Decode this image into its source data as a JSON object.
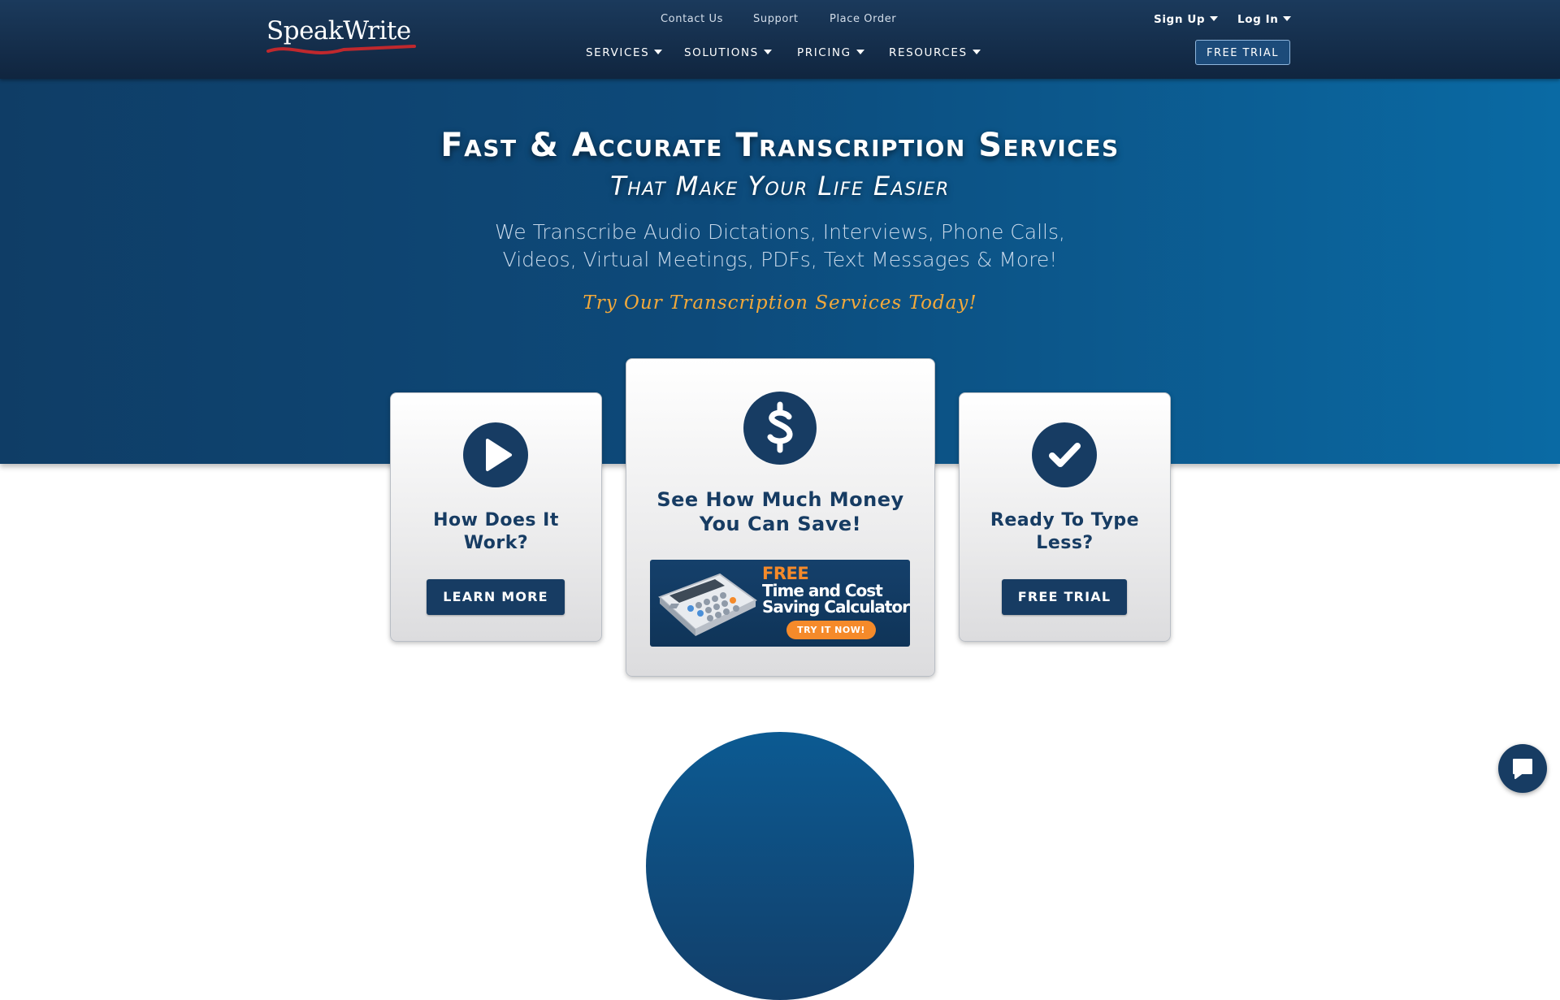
{
  "brand": {
    "logo_text_main": "Speak",
    "logo_text_second": "Write"
  },
  "header": {
    "top_links": [
      "Contact Us",
      "Support",
      "Place Order"
    ],
    "nav": [
      "SERVICES",
      "SOLUTIONS",
      "PRICING",
      "RESOURCES"
    ],
    "account": {
      "signup": "Sign Up",
      "login": "Log In"
    },
    "free_trial": "FREE TRIAL"
  },
  "hero": {
    "title": "Fast & Accurate Transcription Services",
    "subtitle": "That Make Your Life Easier",
    "description_line1": "We Transcribe Audio Dictations, Interviews, Phone Calls,",
    "description_line2": "Videos, Virtual Meetings, PDFs, Text Messages & More!",
    "cta": "Try Our Transcription Services Today!"
  },
  "cards": {
    "left": {
      "title_line1": "How Does It",
      "title_line2": "Work?",
      "button": "LEARN MORE"
    },
    "middle": {
      "title_line1": "See How Much Money",
      "title_line2": "You Can Save!",
      "banner": {
        "free": "FREE",
        "line1": "Time and Cost",
        "line2": "Saving Calculator",
        "button": "TRY IT NOW!"
      }
    },
    "right": {
      "title_line1": "Ready To Type",
      "title_line2": "Less?",
      "button": "FREE TRIAL"
    }
  },
  "colors": {
    "header_bg": "#10253f",
    "hero_bg": "#0d4a7a",
    "accent_navy": "#173c63",
    "cta_orange": "#f2a93b",
    "logo_red": "#c0282d"
  },
  "icons": [
    "play-icon",
    "dollar-icon",
    "check-icon",
    "caret-down-icon",
    "chat-icon",
    "calculator-icon"
  ]
}
